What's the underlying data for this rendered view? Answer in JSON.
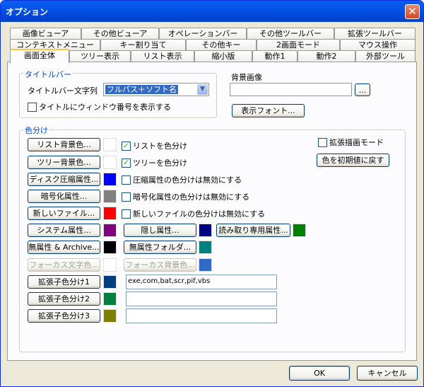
{
  "window": {
    "title": "オプション"
  },
  "tabs": {
    "row1": [
      "画像ビューア",
      "その他ビューア",
      "オペレーションバー",
      "その他ツールバー",
      "拡張ツールバー"
    ],
    "row2": [
      "コンテキストメニュー",
      "キー割り当て",
      "その他キー",
      "2画面モード",
      "マウス操作"
    ],
    "row3": [
      "画面全体",
      "ツリー表示",
      "リスト表示",
      "縮小版",
      "動作1",
      "動作2",
      "外部ツール"
    ]
  },
  "titlebar_group": {
    "label": "タイトルバー",
    "text_label": "タイトルバー文字列",
    "select_value": "フルパス＋ソフト名",
    "show_window_number": "タイトルにウィンドウ番号を表示する"
  },
  "background": {
    "label": "背景画像",
    "browse": "...",
    "display_font": "表示フォント..."
  },
  "colors": {
    "label": "色分け",
    "list_bg": "リスト背景色...",
    "tree_bg": "ツリー背景色...",
    "disk_compress": "ディスク圧縮属性...",
    "encrypt": "暗号化属性...",
    "new_file": "新しいファイル...",
    "system": "システム属性...",
    "no_attr": "無属性 & Archive...",
    "focus_text": "フォーカス文字色...",
    "ext1": "拡張子色分け1",
    "ext2": "拡張子色分け2",
    "ext3": "拡張子色分け3",
    "hidden": "隠し属性...",
    "no_attr_folder": "無属性フォルダ...",
    "focus_bg": "フォーカス背景色...",
    "readonly": "読み取り専用属性...",
    "cb_list": "リストを色分け",
    "cb_tree": "ツリーを色分け",
    "cb_compress": "圧縮属性の色分けは無効にする",
    "cb_encrypt": "暗号化属性の色分けは無効にする",
    "cb_newfile": "新しいファイルの色分けは無効にする",
    "cb_extdraw": "拡張描画モード",
    "reset": "色を初期値に戻す",
    "ext1_value": "exe,com,bat,scr,pif,vbs",
    "swatch": {
      "list_bg": "#FFFFFF",
      "tree_bg": "#FFFFFF",
      "compress": "#0000FF",
      "encrypt": "#808080",
      "newfile": "#FF0000",
      "system": "#800080",
      "noattr": "#000000",
      "focus_text": "#FFFFFF",
      "ext1": "#003F7F",
      "ext2": "#008040",
      "ext3": "#808000",
      "hidden": "#000080",
      "noattr_folder": "#008080",
      "focus_bg": "#316AC5",
      "readonly": "#008000"
    }
  },
  "footer": {
    "ok": "OK",
    "cancel": "キャンセル"
  }
}
